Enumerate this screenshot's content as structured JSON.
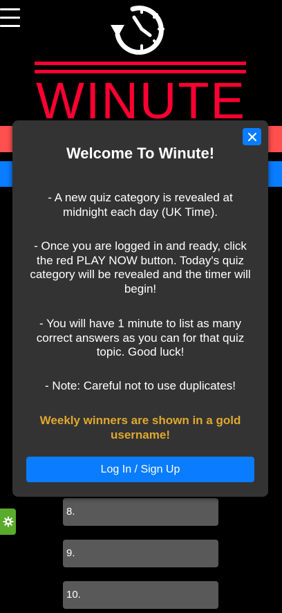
{
  "header": {
    "logo_text": "WINUTE"
  },
  "answers": [
    {
      "label": "8."
    },
    {
      "label": "9."
    },
    {
      "label": "10."
    }
  ],
  "modal": {
    "title": "Welcome To Winute!",
    "paragraphs": [
      "- A new quiz category is revealed at midnight each day (UK Time).",
      "- Once you are logged in and ready, click the red PLAY NOW button. Today's quiz category will be revealed and the timer will begin!",
      "- You will have 1 minute to list as many correct answers as you can for that quiz topic. Good luck!",
      "- Note: Careful not to use duplicates!"
    ],
    "gold_note": "Weekly winners are shown in a gold username!",
    "login_label": "Log In / Sign Up"
  },
  "icons": {
    "menu": "menu-icon",
    "logo": "clock-arrow-icon",
    "close": "close-icon",
    "settings": "gear-icon"
  },
  "colors": {
    "background": "#000000",
    "brand_red": "#ff0033",
    "stripe_red": "#ff5050",
    "accent_blue": "#0a7cff",
    "modal_bg": "#333333",
    "gold": "#e0a82e",
    "settings_green": "#5aab2c",
    "input_bg": "#595959"
  }
}
